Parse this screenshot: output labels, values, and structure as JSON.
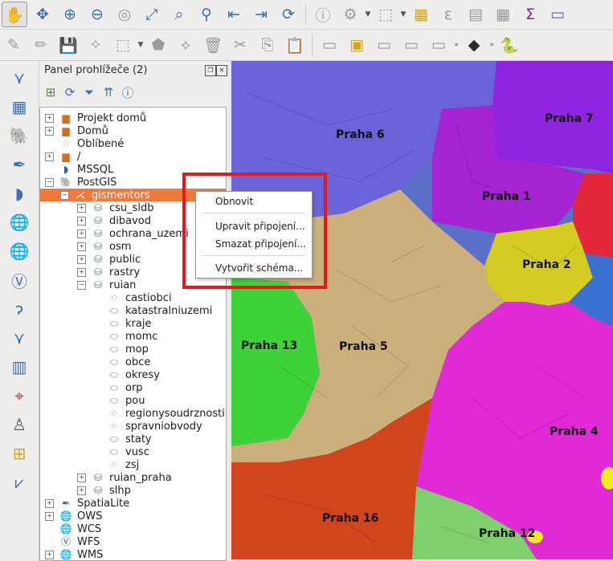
{
  "panel": {
    "title": "Panel prohlížeče (2)"
  },
  "tree": {
    "roots": [
      {
        "label": "Projekt domů"
      },
      {
        "label": "Domů"
      },
      {
        "label": "Oblíbené"
      },
      {
        "label": "/"
      },
      {
        "label": "MSSQL"
      },
      {
        "label": "PostGIS"
      }
    ],
    "connection": "gismentors",
    "schemas": [
      "csu_sldb",
      "dibavod",
      "ochrana_uzemi",
      "osm",
      "public",
      "rastry",
      "ruian"
    ],
    "ruian_layers": [
      "castiobci",
      "katastralniuzemi",
      "kraje",
      "momc",
      "mop",
      "obce",
      "okresy",
      "orp",
      "pou",
      "regionysoudrznosti",
      "spravniobvody",
      "staty",
      "vusc",
      "zsj"
    ],
    "after_schemas": [
      "ruian_praha",
      "slhp"
    ],
    "tail": [
      "SpatiaLite",
      "OWS",
      "WCS",
      "WFS",
      "WMS"
    ]
  },
  "context_menu": {
    "items": [
      "Obnovit",
      "Upravit připojení...",
      "Smazat připojení...",
      "Vytvořit schéma..."
    ]
  },
  "map": {
    "districts": [
      "Praha 6",
      "Praha 7",
      "Praha 1",
      "Praha 2",
      "Praha 13",
      "Praha 5",
      "Praha 4",
      "Praha 16",
      "Praha 12"
    ]
  },
  "colors": {
    "selection": "#f07a3c",
    "highlight": "#e41a1a"
  }
}
